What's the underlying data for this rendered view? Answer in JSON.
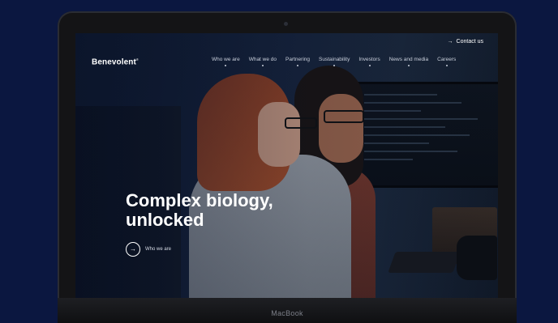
{
  "device": {
    "label": "MacBook"
  },
  "site": {
    "contact_label": "Contact us",
    "logo": "Benevolent",
    "nav": [
      "Who we are",
      "What we do",
      "Partnering",
      "Sustainability",
      "Investors",
      "News and media",
      "Careers"
    ],
    "hero": {
      "title_line1": "Complex biology,",
      "title_line2": "unlocked",
      "cta_label": "Who we are"
    }
  },
  "colors": {
    "background": "#0b1740",
    "text": "#ffffff"
  },
  "icons": {
    "contact": "arrow-right-icon",
    "cta": "arrow-right-icon"
  }
}
